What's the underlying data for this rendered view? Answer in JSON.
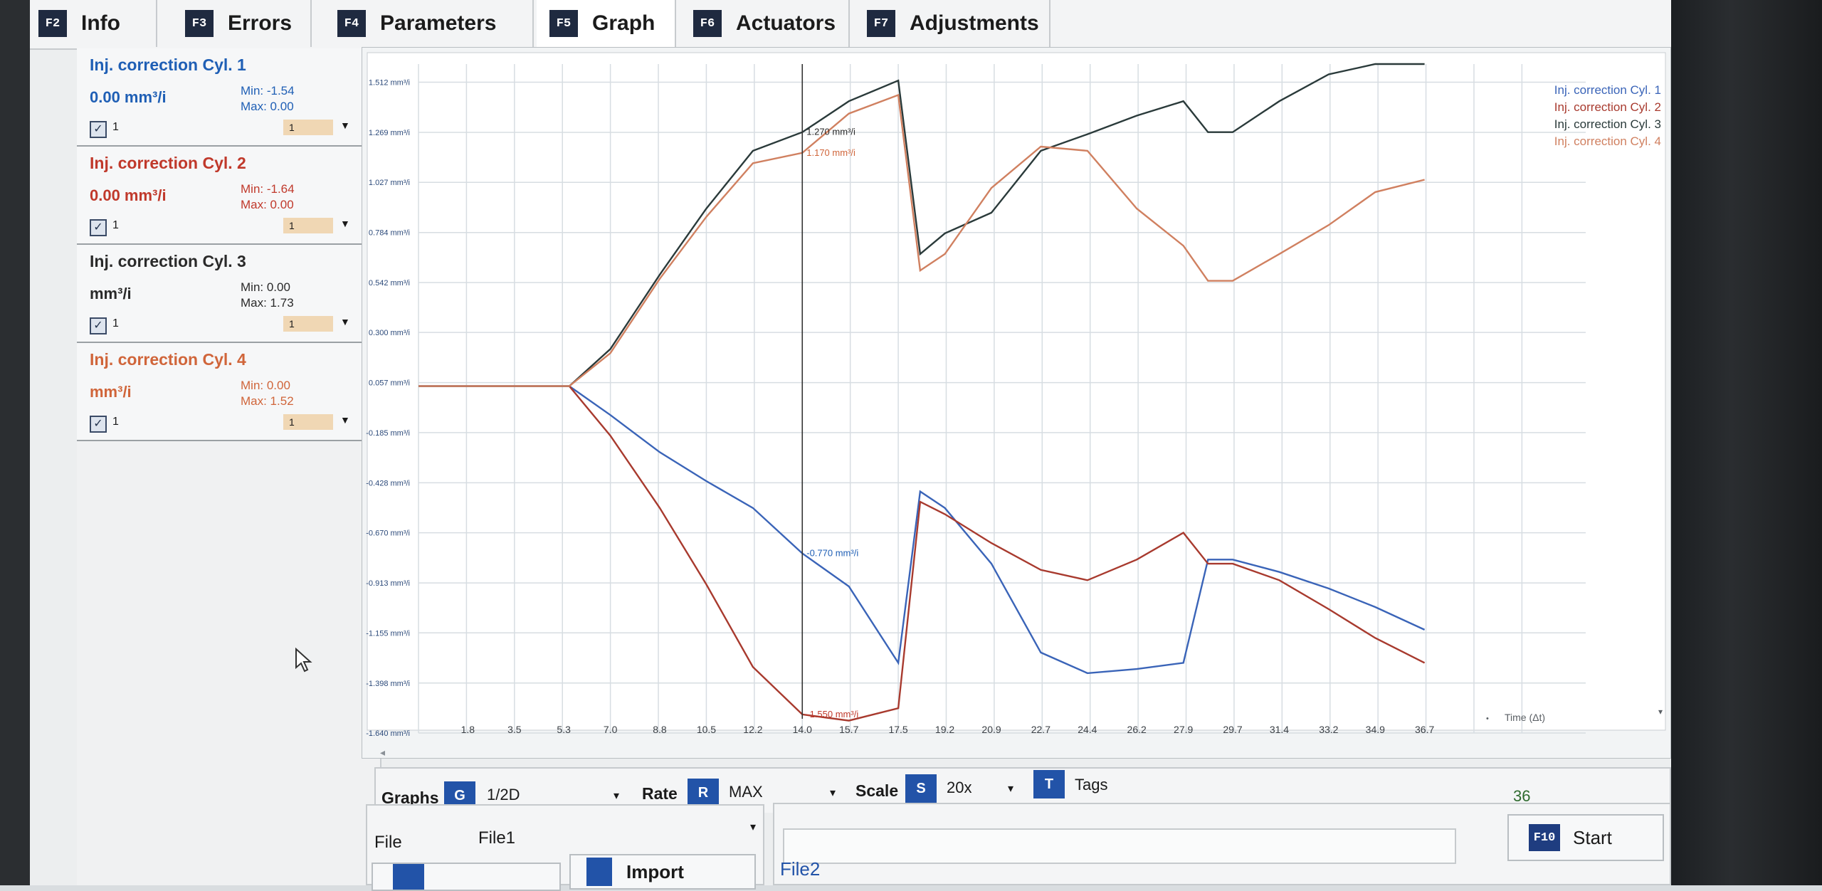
{
  "tabs": [
    {
      "key": "F2",
      "label": "Info"
    },
    {
      "key": "F3",
      "label": "Errors"
    },
    {
      "key": "F4",
      "label": "Parameters"
    },
    {
      "key": "F5",
      "label": "Graph"
    },
    {
      "key": "F6",
      "label": "Actuators"
    },
    {
      "key": "F7",
      "label": "Adjustments"
    }
  ],
  "cylinders": [
    {
      "title": "Inj. correction Cyl. 1",
      "value": "0.00 mm³/i",
      "min": "Min: -1.54",
      "max": "Max: 0.00",
      "check_label": "1",
      "select": "1",
      "color": "#1f5fb5"
    },
    {
      "title": "Inj. correction Cyl. 2",
      "value": "0.00 mm³/i",
      "min": "Min: -1.64",
      "max": "Max: 0.00",
      "check_label": "1",
      "select": "1",
      "color": "#c0392b"
    },
    {
      "title": "Inj. correction Cyl. 3",
      "value": "mm³/i",
      "min": "Min: 0.00",
      "max": "Max: 1.73",
      "check_label": "1",
      "select": "1",
      "color": "#2a2a2a"
    },
    {
      "title": "Inj. correction Cyl. 4",
      "value": "mm³/i",
      "min": "Min: 0.00",
      "max": "Max: 1.52",
      "check_label": "1",
      "select": "1",
      "color": "#d0653a"
    }
  ],
  "controls": {
    "graphs_label": "Graphs",
    "graphs_key": "G",
    "graphs_value": "1/2D",
    "rate_label": "Rate",
    "rate_key": "R",
    "rate_value": "MAX",
    "scale_label": "Scale",
    "scale_key": "S",
    "scale_value": "20x",
    "tags_key": "T",
    "tags_label": "Tags",
    "counter": "36",
    "file_label": "File",
    "file_value": "File1",
    "file2_value": "File2",
    "import_label": "Import",
    "start_key": "F10",
    "start_label": "Start"
  },
  "chart_data": {
    "type": "line",
    "x": [
      0,
      1.8,
      3.5,
      5.3,
      7.0,
      8.8,
      10.5,
      12.2,
      14.0,
      15.7,
      17.5,
      19.2,
      20.9,
      22.7,
      24.4,
      26.2,
      27.9,
      29.7,
      31.4,
      33.2,
      34.9,
      36.7
    ],
    "xtick_labels": [
      "1.8",
      "3.5",
      "5.3",
      "7.0",
      "8.8",
      "10.5",
      "12.2",
      "14.0",
      "15.7",
      "17.5",
      "19.2",
      "20.9",
      "22.7",
      "24.4",
      "26.2",
      "27.9",
      "29.7",
      "31.4",
      "33.2",
      "34.9",
      "36.7"
    ],
    "ytick_labels": [
      "1.512 mm³/i",
      "1.269 mm³/i",
      "1.027 mm³/i",
      "0.784 mm³/i",
      "0.542 mm³/i",
      "0.300 mm³/i",
      "0.057 mm³/i",
      "-0.185 mm³/i",
      "-0.428 mm³/i",
      "-0.670 mm³/i",
      "-0.913 mm³/i",
      "-1.155 mm³/i",
      "-1.398 mm³/i",
      "-1.640 mm³/i"
    ],
    "ylim": [
      -1.64,
      1.6
    ],
    "xlim": [
      0,
      40.5
    ],
    "xlabel": "Time (Δt)",
    "cursor_x": 14.0,
    "cursor_labels": [
      {
        "text": "1.270 mm³/i",
        "y": 1.27,
        "color": "#2a2a2a"
      },
      {
        "text": "1.170 mm³/i",
        "y": 1.17,
        "color": "#d0653a"
      },
      {
        "text": "-0.770 mm³/i",
        "y": -0.77,
        "color": "#1f5fb5"
      },
      {
        "text": "-1.550 mm³/i",
        "y": -1.55,
        "color": "#c0392b"
      }
    ],
    "legend_position": "top-right",
    "grid": true,
    "series": [
      {
        "name": "Inj. correction Cyl. 1",
        "color": "#3a64b8",
        "points": [
          [
            0,
            0.04
          ],
          [
            5.5,
            0.04
          ],
          [
            7.0,
            -0.1
          ],
          [
            8.8,
            -0.28
          ],
          [
            10.5,
            -0.42
          ],
          [
            12.2,
            -0.55
          ],
          [
            14.0,
            -0.77
          ],
          [
            15.7,
            -0.93
          ],
          [
            17.5,
            -1.3
          ],
          [
            18.3,
            -0.47
          ],
          [
            19.2,
            -0.55
          ],
          [
            20.9,
            -0.82
          ],
          [
            22.7,
            -1.25
          ],
          [
            24.4,
            -1.35
          ],
          [
            26.2,
            -1.33
          ],
          [
            27.9,
            -1.3
          ],
          [
            28.8,
            -0.8
          ],
          [
            29.7,
            -0.8
          ],
          [
            31.4,
            -0.86
          ],
          [
            33.2,
            -0.94
          ],
          [
            34.9,
            -1.03
          ],
          [
            36.7,
            -1.14
          ]
        ]
      },
      {
        "name": "Inj. correction Cyl. 2",
        "color": "#a83a2e",
        "points": [
          [
            0,
            0.04
          ],
          [
            5.5,
            0.04
          ],
          [
            7.0,
            -0.2
          ],
          [
            8.8,
            -0.55
          ],
          [
            10.5,
            -0.92
          ],
          [
            12.2,
            -1.32
          ],
          [
            14.0,
            -1.55
          ],
          [
            15.7,
            -1.58
          ],
          [
            17.5,
            -1.52
          ],
          [
            18.3,
            -0.52
          ],
          [
            19.2,
            -0.58
          ],
          [
            20.9,
            -0.72
          ],
          [
            22.7,
            -0.85
          ],
          [
            24.4,
            -0.9
          ],
          [
            26.2,
            -0.8
          ],
          [
            27.9,
            -0.67
          ],
          [
            28.8,
            -0.82
          ],
          [
            29.7,
            -0.82
          ],
          [
            31.4,
            -0.9
          ],
          [
            33.2,
            -1.04
          ],
          [
            34.9,
            -1.18
          ],
          [
            36.7,
            -1.3
          ]
        ]
      },
      {
        "name": "Inj. correction Cyl. 3",
        "color": "#2a3a3a",
        "points": [
          [
            0,
            0.04
          ],
          [
            5.5,
            0.04
          ],
          [
            7.0,
            0.22
          ],
          [
            8.8,
            0.58
          ],
          [
            10.5,
            0.9
          ],
          [
            12.2,
            1.18
          ],
          [
            14.0,
            1.27
          ],
          [
            15.7,
            1.42
          ],
          [
            17.5,
            1.52
          ],
          [
            18.3,
            0.68
          ],
          [
            19.2,
            0.78
          ],
          [
            20.9,
            0.88
          ],
          [
            22.7,
            1.18
          ],
          [
            24.4,
            1.26
          ],
          [
            26.2,
            1.35
          ],
          [
            27.9,
            1.42
          ],
          [
            28.8,
            1.27
          ],
          [
            29.7,
            1.27
          ],
          [
            31.4,
            1.42
          ],
          [
            33.2,
            1.55
          ],
          [
            34.9,
            1.6
          ],
          [
            36.7,
            1.6
          ]
        ]
      },
      {
        "name": "Inj. correction Cyl. 4",
        "color": "#d08060",
        "points": [
          [
            0,
            0.04
          ],
          [
            5.5,
            0.04
          ],
          [
            7.0,
            0.2
          ],
          [
            8.8,
            0.56
          ],
          [
            10.5,
            0.86
          ],
          [
            12.2,
            1.12
          ],
          [
            14.0,
            1.17
          ],
          [
            15.7,
            1.36
          ],
          [
            17.5,
            1.45
          ],
          [
            18.3,
            0.6
          ],
          [
            19.2,
            0.68
          ],
          [
            20.9,
            1.0
          ],
          [
            22.7,
            1.2
          ],
          [
            24.4,
            1.18
          ],
          [
            26.2,
            0.9
          ],
          [
            27.9,
            0.72
          ],
          [
            28.8,
            0.55
          ],
          [
            29.7,
            0.55
          ],
          [
            31.4,
            0.68
          ],
          [
            33.2,
            0.82
          ],
          [
            34.9,
            0.98
          ],
          [
            36.7,
            1.04
          ]
        ]
      }
    ]
  }
}
